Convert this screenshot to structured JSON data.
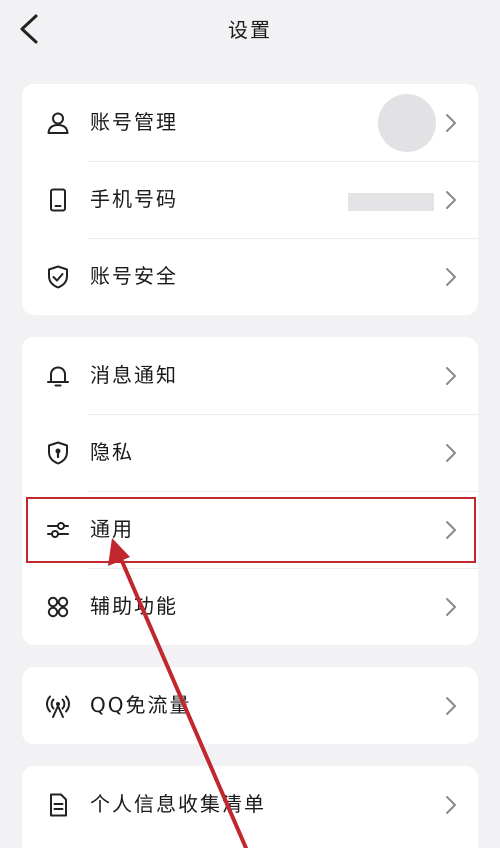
{
  "header": {
    "title": "设置",
    "back_icon": "chevron-left-icon"
  },
  "groups": [
    {
      "items": [
        {
          "label": "账号管理",
          "icon": "person-icon",
          "trailing": "avatar"
        },
        {
          "label": "手机号码",
          "icon": "phone-icon",
          "trailing": "masked-value"
        },
        {
          "label": "账号安全",
          "icon": "shield-check-icon"
        }
      ]
    },
    {
      "items": [
        {
          "label": "消息通知",
          "icon": "bell-icon"
        },
        {
          "label": "隐私",
          "icon": "shield-lock-icon"
        },
        {
          "label": "通用",
          "icon": "sliders-icon",
          "highlighted": true
        },
        {
          "label": "辅助功能",
          "icon": "grid-icon"
        }
      ]
    },
    {
      "items": [
        {
          "label": "QQ免流量",
          "icon": "signal-tower-icon"
        }
      ]
    },
    {
      "items": [
        {
          "label": "个人信息收集清单",
          "icon": "document-icon"
        }
      ]
    }
  ],
  "annotation": {
    "color": "#c1272d",
    "target": "通用"
  },
  "colors": {
    "background": "#f2f2f5",
    "card": "#ffffff",
    "annotation": "#c1272d"
  }
}
